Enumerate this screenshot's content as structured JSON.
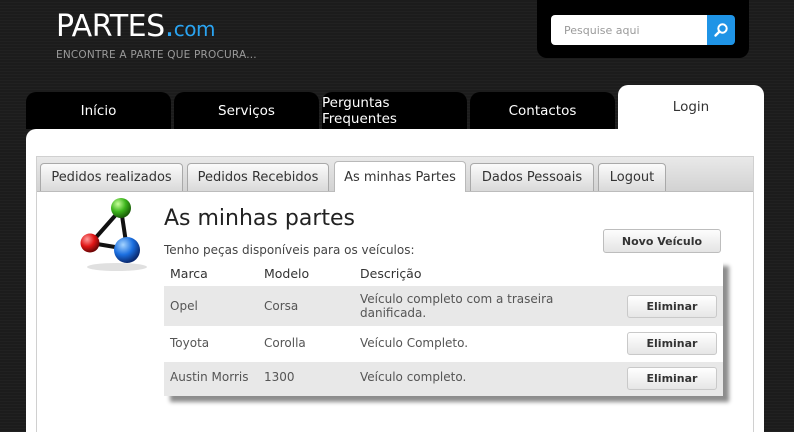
{
  "header": {
    "logo_main": "PARTES",
    "logo_dot": ".",
    "logo_suffix": "com",
    "tagline": "ENCONTRE A PARTE QUE PROCURA..."
  },
  "search": {
    "placeholder": "Pesquise aqui",
    "icon": "search-icon"
  },
  "nav": {
    "tabs": [
      {
        "label": "Início"
      },
      {
        "label": "Serviços"
      },
      {
        "label": "Perguntas Frequentes"
      },
      {
        "label": "Contactos"
      },
      {
        "label": "Login",
        "active": true
      }
    ]
  },
  "subtabs": [
    {
      "label": "Pedidos realizados"
    },
    {
      "label": "Pedidos Recebidos"
    },
    {
      "label": "As minhas Partes",
      "active": true
    },
    {
      "label": "Dados Pessoais"
    },
    {
      "label": "Logout"
    }
  ],
  "page": {
    "title": "As minhas partes",
    "subtitle": "Tenho peças disponíveis para os veículos:",
    "new_vehicle_label": "Novo Veículo",
    "icon": "molecule-icon"
  },
  "table": {
    "columns": [
      "Marca",
      "Modelo",
      "Descrição"
    ],
    "rows": [
      {
        "marca": "Opel",
        "modelo": "Corsa",
        "descricao_line1": "Veículo completo com a traseira",
        "descricao_line2": "danificada.",
        "action": "Eliminar"
      },
      {
        "marca": "Toyota",
        "modelo": "Corolla",
        "descricao_line1": "Veículo Completo.",
        "descricao_line2": "",
        "action": "Eliminar"
      },
      {
        "marca": "Austin Morris",
        "modelo": "1300",
        "descricao_line1": "Veículo completo.",
        "descricao_line2": "",
        "action": "Eliminar"
      }
    ]
  },
  "colors": {
    "accent": "#1f94e6",
    "header_bg": "#1c1c1c",
    "row_shaded": "#e8e8e8"
  }
}
